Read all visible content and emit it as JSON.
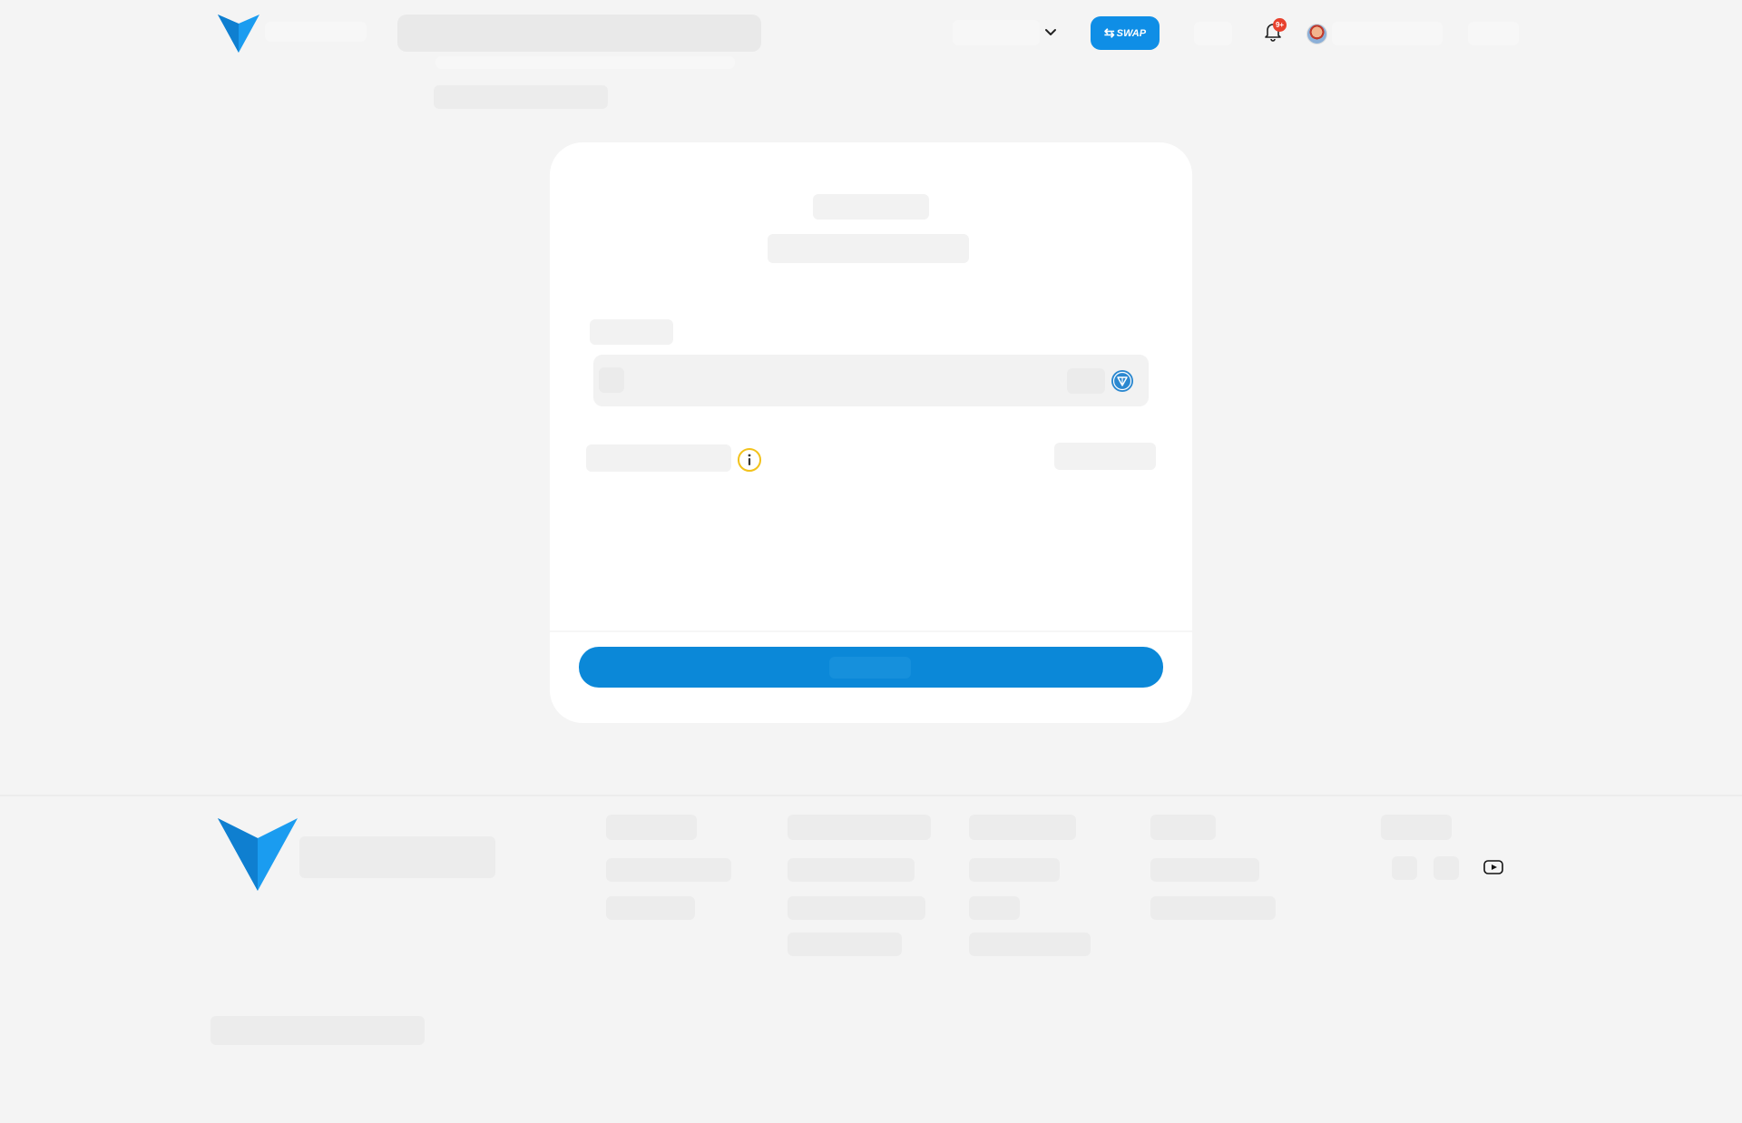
{
  "header": {
    "swap_label": "SWAP",
    "notification_badge": "9+"
  },
  "icons": {
    "logo": "logo-icon",
    "chevron": "chevron-down-icon",
    "bell": "bell-icon",
    "avatar": "avatar",
    "token": "token-icon",
    "info": "info-icon",
    "youtube": "youtube-icon"
  },
  "colors": {
    "brand_blue": "#1a9cf0",
    "primary_button": "#0b88d8",
    "badge_red": "#e8412d",
    "info_yellow": "#f2c21b",
    "background": "#f4f4f4",
    "card": "#ffffff"
  }
}
